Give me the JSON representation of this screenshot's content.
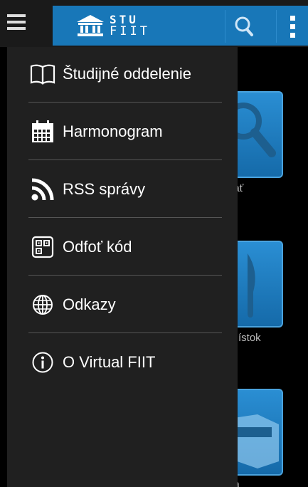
{
  "appbar": {
    "logo_line1": "STU",
    "logo_line2": "FIIT",
    "brand_color": "#1877b8",
    "icons": [
      "hamburger-icon",
      "university-logo-icon",
      "search-icon",
      "overflow-menu-icon"
    ]
  },
  "drawer": {
    "items": [
      {
        "label": "Študijné oddelenie",
        "icon": "book-icon"
      },
      {
        "label": "Harmonogram",
        "icon": "calendar-icon"
      },
      {
        "label": "RSS správy",
        "icon": "rss-icon"
      },
      {
        "label": "Odfoť kód",
        "icon": "qr-code-icon"
      },
      {
        "label": "Odkazy",
        "icon": "globe-icon"
      },
      {
        "label": "O Virtual FIIT",
        "icon": "info-icon"
      }
    ]
  },
  "background_tiles": {
    "labels": [
      "dať",
      "y lístok",
      "pa"
    ],
    "icons": [
      "search-tile-icon",
      "knife-tile-icon",
      "fiit-map-tile-icon"
    ]
  }
}
